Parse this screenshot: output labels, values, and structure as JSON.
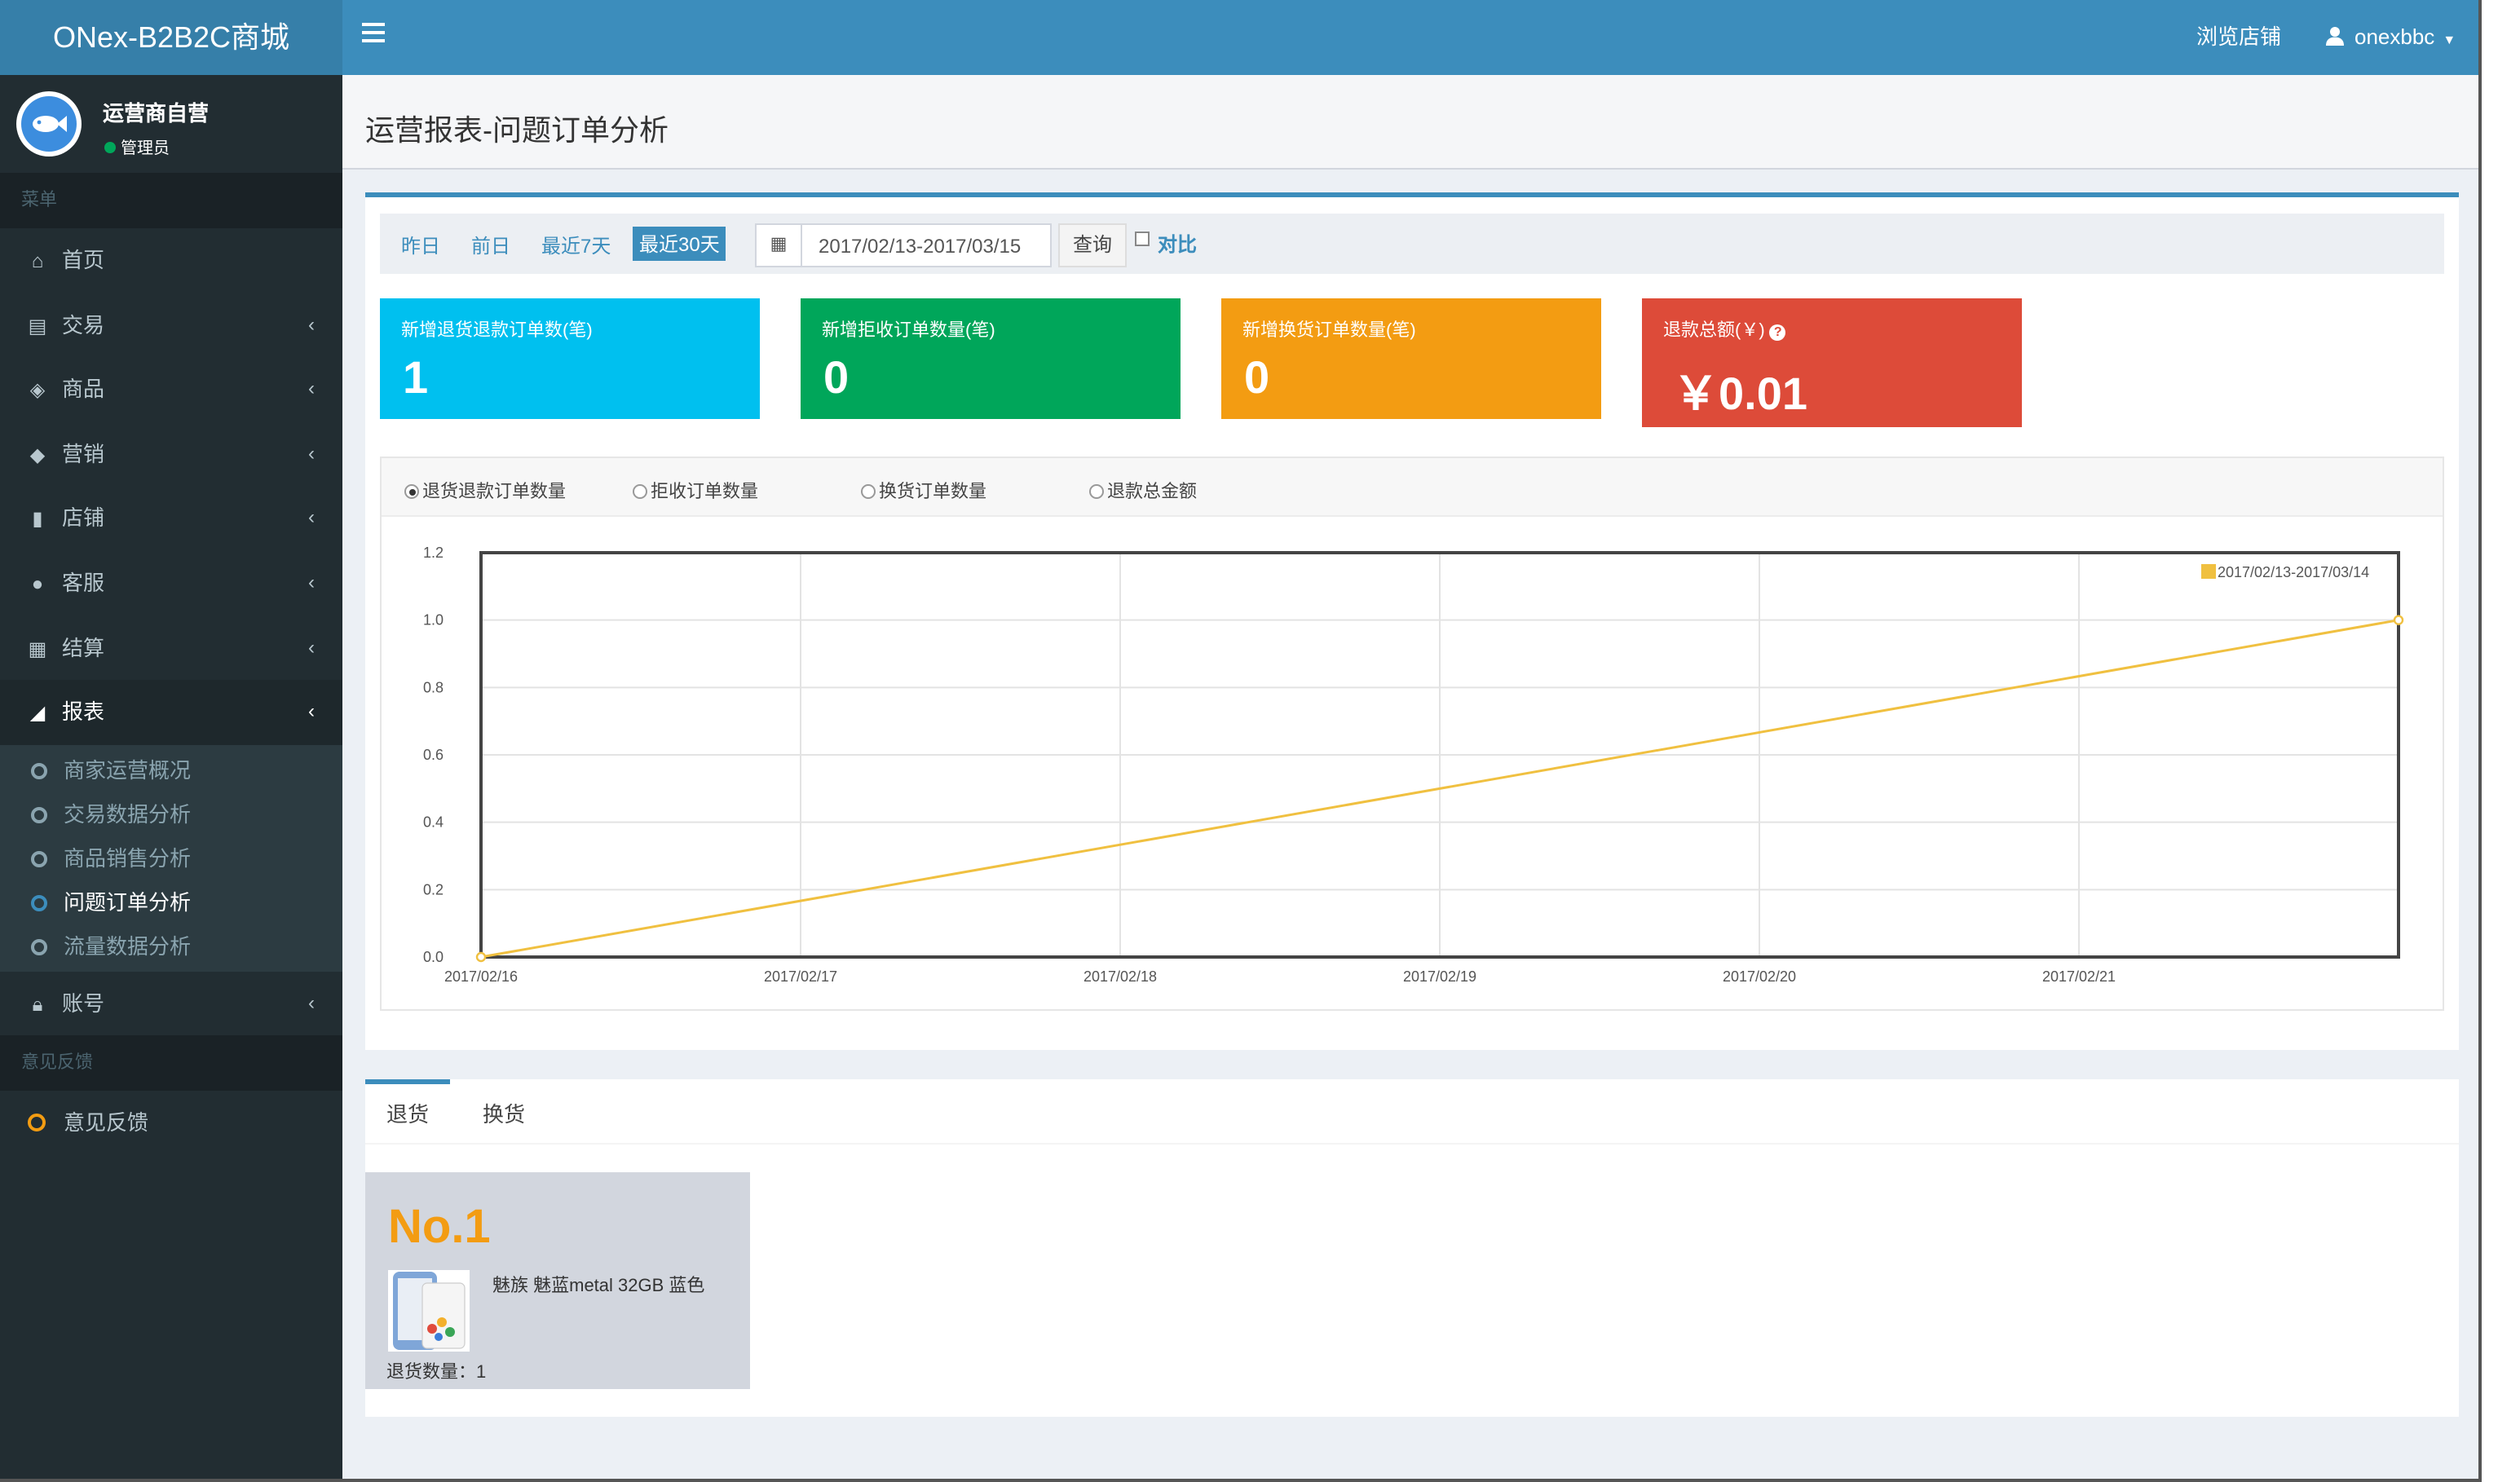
{
  "app_title": "ONex-B2B2C商城",
  "header": {
    "browse_store": "浏览店铺",
    "user": "onexbbc"
  },
  "sidebar": {
    "user_name": "运营商自营",
    "user_role": "管理员",
    "menu_section": "菜单",
    "feedback_section": "意见反馈",
    "items": [
      {
        "label": "首页",
        "icon": "home-icon"
      },
      {
        "label": "交易",
        "icon": "card-icon"
      },
      {
        "label": "商品",
        "icon": "cube-icon"
      },
      {
        "label": "营销",
        "icon": "tags-icon"
      },
      {
        "label": "店铺",
        "icon": "building-icon"
      },
      {
        "label": "客服",
        "icon": "comments-icon"
      },
      {
        "label": "结算",
        "icon": "calculator-icon"
      },
      {
        "label": "报表",
        "icon": "area-chart-icon"
      }
    ],
    "report_sub": [
      "商家运营概况",
      "交易数据分析",
      "商品销售分析",
      "问题订单分析",
      "流量数据分析"
    ],
    "account": "账号",
    "feedback": "意见反馈"
  },
  "page_title": "运营报表-问题订单分析",
  "filters": {
    "yesterday": "昨日",
    "day_before": "前日",
    "last7": "最近7天",
    "last30": "最近30天",
    "date_range": "2017/02/13-2017/03/15",
    "query": "查询",
    "compare": "对比"
  },
  "cards": [
    {
      "label": "新增退货退款订单数(笔)",
      "value": "1",
      "color": "#00c0ef"
    },
    {
      "label": "新增拒收订单数量(笔)",
      "value": "0",
      "color": "#00a65a"
    },
    {
      "label": "新增换货订单数量(笔)",
      "value": "0",
      "color": "#f39c12"
    },
    {
      "label": "退款总额(￥)",
      "value": "￥0.01",
      "color": "#dd4b39"
    }
  ],
  "metric_options": [
    "退货退款订单数量",
    "拒收订单数量",
    "换货订单数量",
    "退款总金额"
  ],
  "chart_data": {
    "type": "line",
    "series": [
      {
        "name": "2017/02/13-2017/03/14",
        "color": "#f0c040",
        "x": [
          "2017/02/16",
          "2017/02/22"
        ],
        "y": [
          0,
          1
        ]
      }
    ],
    "x_ticks": [
      "2017/02/16",
      "2017/02/17",
      "2017/02/18",
      "2017/02/19",
      "2017/02/20",
      "2017/02/21"
    ],
    "ylim": [
      0,
      1.2
    ],
    "y_ticks": [
      "0.0",
      "0.2",
      "0.4",
      "0.6",
      "0.8",
      "1.0",
      "1.2"
    ],
    "grid": true,
    "legend": "top-right"
  },
  "tabs": [
    "退货",
    "换货"
  ],
  "ranking": {
    "rank": "No.1",
    "product": "魅族 魅蓝metal 32GB 蓝色",
    "count_label": "退货数量：1"
  }
}
